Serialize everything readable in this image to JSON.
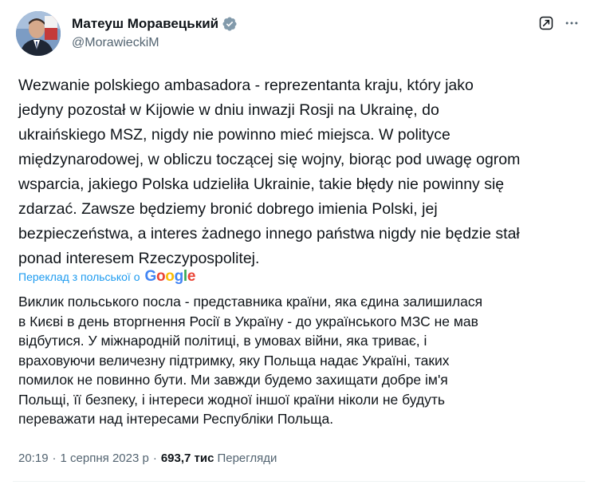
{
  "author": {
    "display_name": "Матеуш Моравецький",
    "handle": "@MorawieckiM",
    "verified": true,
    "avatar_icon": "avatar-portrait"
  },
  "header_actions": [
    {
      "name": "grok-icon"
    },
    {
      "name": "more-options-icon"
    }
  ],
  "tweet": {
    "original_text": "Wezwanie polskiego ambasadora - reprezentanta kraju, który jako\njedyny pozostał w Kijowie w dniu inwazji Rosji na Ukrainę, do\nukraińskiego MSZ, nigdy nie powinno mieć miejsca. W polityce\nmiędzynarodowej, w obliczu toczącej się wojny, biorąc pod uwagę ogrom\nwsparcia, jakiego Polska udzieliła Ukrainie, takie błędy nie powinny się\nzdarzać. Zawsze będziemy bronić dobrego imienia Polski, jej\nbezpieczeństwa, a interes żadnego innego państwa nigdy nie będzie stał\nponad interesem Rzeczypospolitej.",
    "translation_label": "Переклад з польської о",
    "translation_provider": "Google",
    "translated_text": "Виклик польського посла - представника країни, яка єдина залишилася\nв Києві в день вторгнення Росії в Україну - до українського МЗС не мав\nвідбутися. У міжнародній політиці, в умовах війни, яка триває, і\nвраховуючи величезну підтримку, яку Польща надає Україні, таких\nпомилок не повинно бути. Ми завжди будемо захищати добре ім'я\nПольщі, її безпеку, і інтереси жодної іншої країни ніколи не будуть\nпереважати над інтересами Республіки Польща.",
    "time": "20:19",
    "date": "1 серпня 2023 р",
    "separator": "·",
    "views_count": "693,7 тис",
    "views_label": "Перегляди"
  },
  "colors": {
    "link": "#1d9bf0",
    "verified": "#829aab",
    "secondary_text": "#536471",
    "primary_text": "#0f1419"
  }
}
